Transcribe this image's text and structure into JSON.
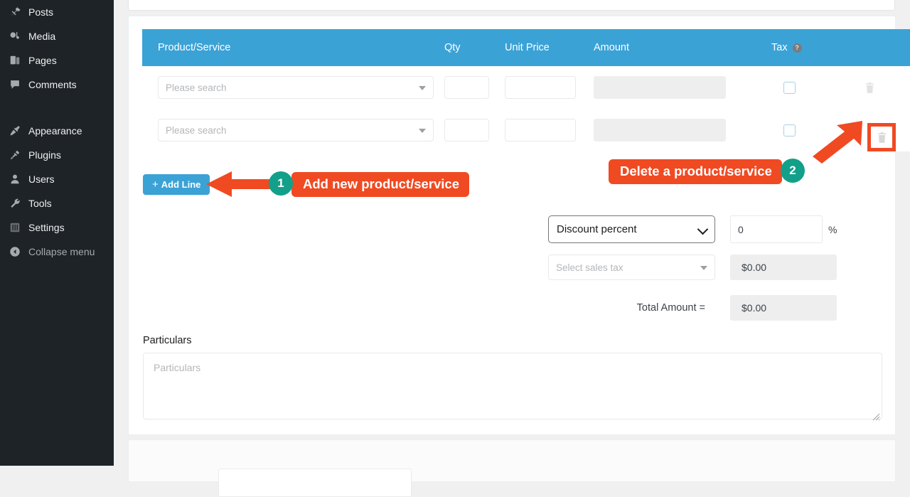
{
  "sidebar": {
    "items": [
      {
        "label": "Posts",
        "icon": "pin-icon",
        "dim": false
      },
      {
        "label": "Media",
        "icon": "media-icon",
        "dim": false
      },
      {
        "label": "Pages",
        "icon": "pages-icon",
        "dim": false
      },
      {
        "label": "Comments",
        "icon": "comment-icon",
        "dim": false
      }
    ],
    "items2": [
      {
        "label": "Appearance",
        "icon": "brush-icon",
        "dim": false
      },
      {
        "label": "Plugins",
        "icon": "plug-icon",
        "dim": false
      },
      {
        "label": "Users",
        "icon": "user-icon",
        "dim": false
      },
      {
        "label": "Tools",
        "icon": "wrench-icon",
        "dim": false
      },
      {
        "label": "Settings",
        "icon": "sliders-icon",
        "dim": false
      },
      {
        "label": "Collapse menu",
        "icon": "collapse-icon",
        "dim": true
      }
    ]
  },
  "invoice_table": {
    "headers": {
      "product": "Product/Service",
      "qty": "Qty",
      "unit_price": "Unit Price",
      "amount": "Amount",
      "tax": "Tax",
      "tax_help_glyph": "?"
    },
    "rows": [
      {
        "product_placeholder": "Please search",
        "qty_value": "",
        "unit_price_value": "",
        "amount_value": "",
        "tax_checked": false,
        "delete_icon": "trash-icon"
      },
      {
        "product_placeholder": "Please search",
        "qty_value": "",
        "unit_price_value": "",
        "amount_value": "",
        "tax_checked": false,
        "delete_icon": "trash-icon"
      }
    ]
  },
  "add_line": {
    "label": "Add Line",
    "plus": "+"
  },
  "annotations": [
    {
      "number": "1",
      "text": "Add new product/service"
    },
    {
      "number": "2",
      "text": "Delete a product/service"
    }
  ],
  "totals": {
    "discount_type": "Discount percent",
    "discount_value": "0",
    "percent_sign": "%",
    "sales_tax_placeholder": "Select sales tax",
    "sales_tax_amount": "$0.00",
    "total_label": "Total Amount =",
    "total_amount": "$0.00"
  },
  "particulars": {
    "label": "Particulars",
    "placeholder": "Particulars"
  },
  "colors": {
    "sidebar_bg": "#1d2327",
    "table_header_bg": "#3ba2d6",
    "accent_blue": "#3ba2d6",
    "annotation_red": "#f04a23",
    "annotation_teal": "#12a08a",
    "page_bg": "#f0f0f1",
    "disabled_field": "#eeeeee",
    "checkbox_border": "#a8d2e3"
  }
}
